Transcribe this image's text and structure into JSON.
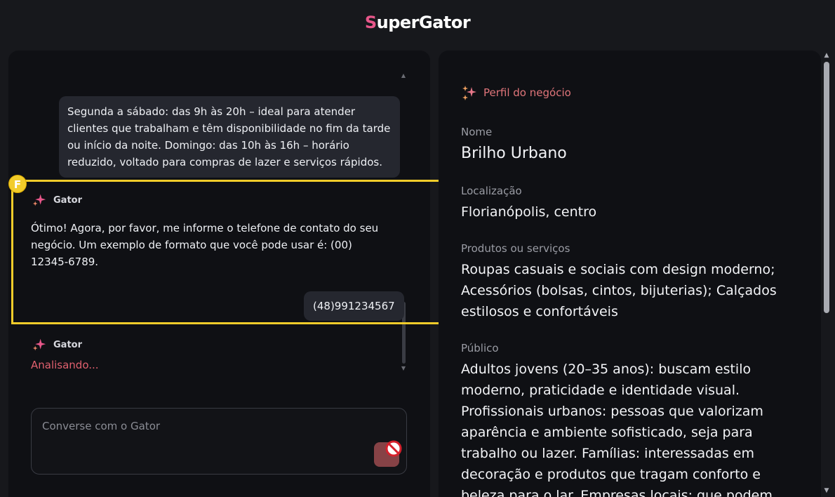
{
  "app": {
    "title_first_letter": "S",
    "title_rest": "uperGator",
    "brand_color": "#e8578a"
  },
  "chat": {
    "messages": [
      {
        "role": "user",
        "text": "Segunda a sábado: das 9h às 20h – ideal para atender clientes que trabalham e têm disponibilidade no fim da tarde ou início da noite. Domingo: das 10h às 16h – horário reduzido, voltado para compras de lazer e serviços rápidos."
      },
      {
        "role": "assistant",
        "name": "Gator",
        "text": "Ótimo! Agora, por favor, me informe o telefone de contato do seu negócio. Um exemplo de formato que você pode usar é: (00) 12345-6789."
      },
      {
        "role": "user",
        "text": "(48)991234567"
      },
      {
        "role": "assistant",
        "name": "Gator",
        "status": "Analisando..."
      }
    ],
    "input": {
      "placeholder": "Converse com o Gator",
      "value": ""
    },
    "highlight_badge": "F",
    "highlight_color": "#f2cc2a"
  },
  "profile": {
    "header": "Perfil do negócio",
    "icon": "sparkles-icon",
    "fields": [
      {
        "label": "Nome",
        "value": "Brilho Urbano"
      },
      {
        "label": "Localização",
        "value": "Florianópolis, centro"
      },
      {
        "label": "Produtos ou serviços",
        "value": "Roupas casuais e sociais com design moderno; Acessórios (bolsas, cintos, bijuterias); Calçados estilosos e confortáveis"
      },
      {
        "label": "Público",
        "value": "Adultos jovens (20–35 anos): buscam estilo moderno, praticidade e identidade visual. Profissionais urbanos: pessoas que valorizam aparência e ambiente sofisticado, seja para trabalho ou lazer. Famílias: interessadas em decoração e produtos que tragam conforto e beleza para o lar. Empresas locais: que podem"
      }
    ]
  }
}
